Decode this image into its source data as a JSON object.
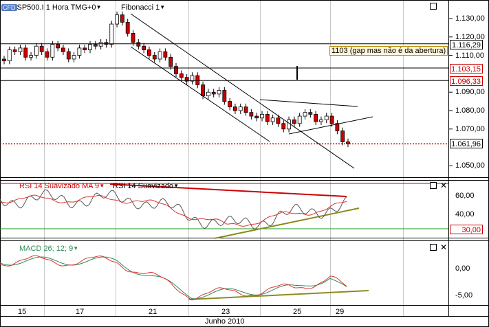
{
  "header": {
    "logo": "CFD",
    "symbol_label": "SP500.I 1 Hora TMG+0",
    "study_label": "Fibonacci 1"
  },
  "annotation": "1103 (gap mas não é da abertura)",
  "price_axis": {
    "ticks": [
      "1.130,00",
      "1.120,00",
      "1.110,00",
      "1.090,00",
      "1.080,00",
      "1.070,00",
      "1.050,00"
    ],
    "boxes": [
      {
        "value": "1.116,29",
        "style": "normal"
      },
      {
        "value": "1.103,15",
        "style": "red"
      },
      {
        "value": "1.096,33",
        "style": "red"
      },
      {
        "value": "1.061,96",
        "style": "normal"
      }
    ]
  },
  "rsi_panel": {
    "label_ma": "RSI 14 Suavizado MA 9",
    "label_rsi": "RSI 14 Suavizado",
    "ticks": [
      "60,00",
      "40,00"
    ],
    "level_box": "30,00"
  },
  "macd_panel": {
    "label": "MACD 26; 12; 9",
    "ticks": [
      "0,00",
      "-5,00"
    ]
  },
  "time_axis": {
    "ticks": [
      "15",
      "17",
      "21",
      "23",
      "25",
      "29"
    ],
    "month_label": "Junho 2010"
  },
  "colors": {
    "up_candle": "#ffffff",
    "down_candle": "#cc0000",
    "rsi_line": "#555555",
    "rsi_ma": "#e03030",
    "macd_signal": "#2e8b57",
    "macd_line": "#e03030",
    "trend_olive": "#8b8b1e",
    "level_green": "#1a9a1a",
    "support_dotted": "#cc0000"
  },
  "chart_data": [
    {
      "type": "candlestick",
      "title": "SP500.I 1 Hora TMG+0",
      "x": [
        "15",
        "17",
        "21",
        "23",
        "25",
        "29"
      ],
      "ylim": [
        1045,
        1137
      ],
      "close_path": [
        1107,
        1113,
        1112,
        1114,
        1109,
        1110,
        1115,
        1112,
        1109,
        1116,
        1114,
        1112,
        1108,
        1110,
        1114,
        1113,
        1116,
        1115,
        1117,
        1116,
        1127,
        1132,
        1128,
        1122,
        1117,
        1115,
        1113,
        1110,
        1108,
        1112,
        1109,
        1104,
        1100,
        1098,
        1096,
        1099,
        1094,
        1088,
        1090,
        1089,
        1091,
        1085,
        1082,
        1080,
        1082,
        1079,
        1077,
        1076,
        1078,
        1074,
        1076,
        1073,
        1070,
        1075,
        1073,
        1077,
        1079,
        1078,
        1074,
        1075,
        1077,
        1073,
        1069,
        1063,
        1062
      ],
      "horizontal_levels": [
        1116.29,
        1103.15,
        1096.33,
        1061.96
      ],
      "annotation": "1103 (gap mas não é da abertura)"
    },
    {
      "type": "line",
      "title": "RSI 14 Suavizado",
      "series": [
        {
          "name": "RSI 14 Suavizado MA 9"
        },
        {
          "name": "RSI 14 Suavizado"
        }
      ],
      "yticks": [
        60,
        40
      ],
      "level": 30
    },
    {
      "type": "line",
      "title": "MACD 26; 12; 9",
      "yticks": [
        0,
        -5
      ]
    }
  ]
}
